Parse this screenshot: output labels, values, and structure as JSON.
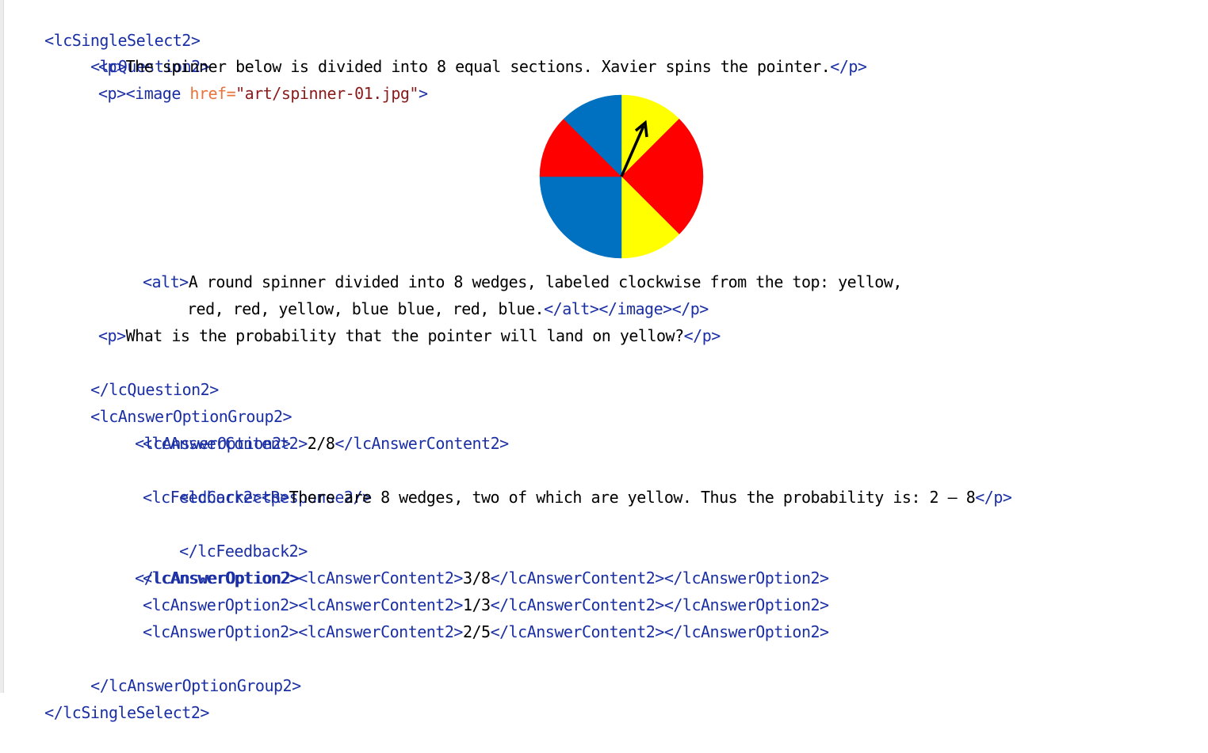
{
  "colors": {
    "tag": "#1b2fa5",
    "attribute_name": "#e8743b",
    "attribute_value": "#8a1a1a",
    "text": "#000000",
    "spinner_yellow": "#ffff00",
    "spinner_red": "#ff0000",
    "spinner_blue": "#0070c0",
    "pointer": "#000000"
  },
  "code": {
    "l1_open": "<lcSingleSelect2>",
    "l2_open": "<lcQuestion2>",
    "l3_popen": "<p>",
    "l3_text": "The spinner below is divided into 8 equal sections. Xavier spins the pointer.",
    "l3_pclose": "</p>",
    "l4_popen": "<p>",
    "l4_image_open": "<image ",
    "l4_attr": "href=",
    "l4_val": "\"art/spinner-01.jpg\"",
    "l4_gt": ">",
    "l5_alt_open": "<alt>",
    "l5_text": "A round spinner divided into 8 wedges, labeled clockwise from the top: yellow,",
    "l6_text": "red, red, yellow, blue blue, red, blue.",
    "l6_close": "</alt></image></p>",
    "l7_popen": "<p>",
    "l7_text": "What is the probability that the pointer will land on yellow?",
    "l7_pclose": "</p>",
    "l8_close": "</lcQuestion2>",
    "l9_open": "<lcAnswerOptionGroup2>",
    "l10_open": "<lcAnswerOption2>",
    "l11_open": "<lcAnswerContent2>",
    "l11_text": "2/8",
    "l11_close": "</lcAnswerContent2>",
    "l12_tag": "<lcCorrectResponse2/>",
    "l13_open": "<lcFeedback2><p>",
    "l13_text": "There are 8 wedges, two of which are yellow. Thus the probability is: 2 — 8",
    "l13_close": "</p>",
    "l14_close": "</lcFeedback2>",
    "l15_close": "</lcAnswerOption2>",
    "l16_open": "<lcAnswerOption2><lcAnswerContent2>",
    "l16_text": "3/8",
    "l16_close": "</lcAnswerContent2></lcAnswerOption2>",
    "l17_open": "<lcAnswerOption2><lcAnswerContent2>",
    "l17_text": "1/3",
    "l17_close": "</lcAnswerContent2></lcAnswerOption2>",
    "l18_open": "<lcAnswerOption2><lcAnswerContent2>",
    "l18_text": "2/5",
    "l18_close": "</lcAnswerContent2></lcAnswerOption2>",
    "l19_close": "</lcAnswerOptionGroup2>",
    "l20_close": "</lcSingleSelect2>"
  },
  "spinner": {
    "wedges_clockwise_from_top": [
      "yellow",
      "red",
      "red",
      "yellow",
      "blue",
      "blue",
      "red",
      "blue"
    ]
  }
}
